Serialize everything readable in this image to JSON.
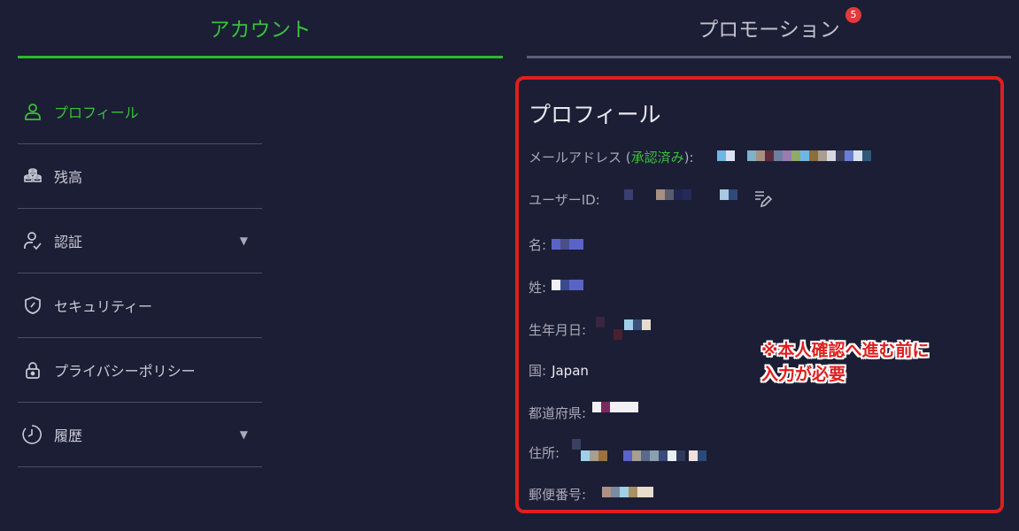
{
  "tabs": [
    {
      "label": "アカウント",
      "active": true
    },
    {
      "label": "プロモーション",
      "badge": "5"
    }
  ],
  "sidebar": {
    "items": [
      {
        "label": "プロフィール",
        "icon": "user-icon",
        "active": true
      },
      {
        "label": "残高",
        "icon": "coins-icon"
      },
      {
        "label": "認証",
        "icon": "user-check-icon",
        "expandable": true
      },
      {
        "label": "セキュリティー",
        "icon": "shield-icon"
      },
      {
        "label": "プライバシーポリシー",
        "icon": "lock-icon"
      },
      {
        "label": "履歴",
        "icon": "clock-icon",
        "expandable": true
      }
    ]
  },
  "profile": {
    "title": "プロフィール",
    "email_label": "メールアドレス",
    "email_verified_open": " (",
    "email_verified": "承認済み",
    "email_verified_close": "):",
    "user_id_label": "ユーザーID:",
    "first_name_label": "名:",
    "last_name_label": "姓:",
    "birthdate_label": "生年月日:",
    "country_label": "国:",
    "country_value": "Japan",
    "prefecture_label": "都道府県:",
    "address_label": "住所:",
    "postal_label": "郵便番号:"
  },
  "note": {
    "line1": "※本人確認へ進む前に",
    "line2": "入力が必要"
  },
  "colors": {
    "accent": "#2eb82e",
    "background": "#1b1e35",
    "highlight_border": "#e01e1e",
    "badge": "#e03a3a"
  }
}
